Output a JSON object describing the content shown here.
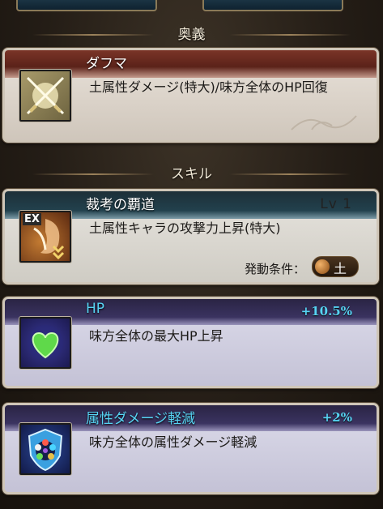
{
  "sections": {
    "ougi_header": "奥義",
    "skill_header": "スキル"
  },
  "ougi": {
    "name": "ダフマ",
    "description": "土属性ダメージ(特大)/味方全体のHP回復",
    "icon": "crossed-swords-icon"
  },
  "skill": {
    "name": "裁考の覇道",
    "level": "Lv 1",
    "badge": "EX",
    "description": "土属性キャラの攻撃力上昇(特大)",
    "condition_label": "発動条件：",
    "condition_value": "土",
    "icon": "ex-skill-icon"
  },
  "auras": [
    {
      "name": "HP",
      "bonus": "+10.5%",
      "description": "味方全体の最大HP上昇",
      "icon": "green-heart-icon"
    },
    {
      "name": "属性ダメージ軽減",
      "bonus": "+2%",
      "description": "味方全体の属性ダメージ軽減",
      "icon": "shield-orbs-icon"
    }
  ],
  "colors": {
    "aura_title": "#57d4f4",
    "ougi_header_bar": "#5b2219",
    "skill_header_bar": "#1d2f38",
    "aura_header_bar": "#2a2444"
  }
}
